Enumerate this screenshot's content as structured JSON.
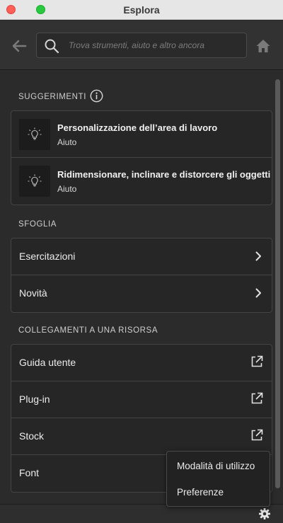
{
  "window": {
    "title": "Esplora"
  },
  "colors": {
    "panel": "#2b2b2b",
    "card": "#262626",
    "border": "#444444",
    "text": "#ececec"
  },
  "toolbar": {
    "back_icon": "arrow-left-icon",
    "search_placeholder": "Trova strumenti, aiuto e altro ancora",
    "search_value": "",
    "home_icon": "home-icon"
  },
  "suggestions": {
    "heading": "SUGGERIMENTI",
    "info_icon": "info-icon",
    "items": [
      {
        "icon": "lightbulb-icon",
        "title": "Personalizzazione dell’area di lavoro",
        "subtitle": "Aiuto"
      },
      {
        "icon": "lightbulb-icon",
        "title": "Ridimensionare, inclinare e distorcere gli oggetti",
        "subtitle": "Aiuto"
      }
    ]
  },
  "browse": {
    "heading": "SFOGLIA",
    "items": [
      {
        "label": "Esercitazioni",
        "icon": "chevron-right-icon"
      },
      {
        "label": "Novità",
        "icon": "chevron-right-icon"
      }
    ]
  },
  "links": {
    "heading": "COLLEGAMENTI A UNA RISORSA",
    "items": [
      {
        "label": "Guida utente",
        "icon": "external-link-icon"
      },
      {
        "label": "Plug-in",
        "icon": "external-link-icon"
      },
      {
        "label": "Stock",
        "icon": "external-link-icon"
      },
      {
        "label": "Font",
        "icon": "external-link-icon"
      }
    ]
  },
  "footer": {
    "gear_icon": "gear-icon"
  },
  "popup_menu": {
    "items": [
      {
        "label": "Modalità di utilizzo"
      },
      {
        "label": "Preferenze"
      }
    ]
  }
}
